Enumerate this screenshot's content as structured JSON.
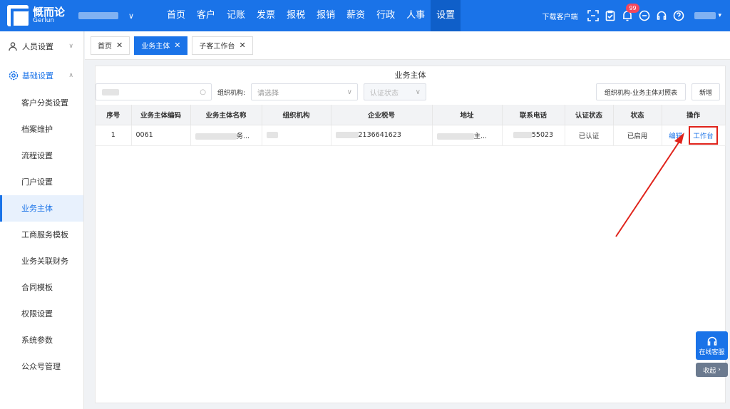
{
  "brand": {
    "name": "慨而论",
    "sub": "Gerlun"
  },
  "topnav": [
    "首页",
    "客户",
    "记账",
    "发票",
    "报税",
    "报销",
    "薪资",
    "行政",
    "人事",
    "设置"
  ],
  "topnav_active": "设置",
  "top_right": {
    "download": "下载客户端",
    "badge": "99"
  },
  "sidebar": {
    "groups": [
      {
        "label": "人员设置",
        "icon": "person-icon"
      },
      {
        "label": "基础设置",
        "icon": "gear-icon"
      }
    ],
    "items": [
      "客户分类设置",
      "档案维护",
      "流程设置",
      "门户设置",
      "业务主体",
      "工商服务模板",
      "业务关联财务",
      "合同模板",
      "权限设置",
      "系统参数",
      "公众号管理"
    ],
    "active": "业务主体"
  },
  "tabs": [
    {
      "label": "首页"
    },
    {
      "label": "业务主体"
    },
    {
      "label": "子客工作台"
    }
  ],
  "panel": {
    "title": "业务主体",
    "org_label": "组织机构:",
    "org_placeholder": "请选择",
    "status_placeholder": "认证状态",
    "btn_report": "组织机构-业务主体对照表",
    "btn_add": "新增"
  },
  "table": {
    "headers": [
      "序号",
      "业务主体编码",
      "业务主体名称",
      "组织机构",
      "企业税号",
      "地址",
      "联系电话",
      "认证状态",
      "状态",
      "操作"
    ],
    "rows": [
      {
        "index": "1",
        "code": "0061",
        "name_tail": "务...",
        "tax_tail": "2136641623",
        "addr_tail": "主...",
        "phone_tail": "55023",
        "auth": "已认证",
        "status": "已启用",
        "op_edit": "编辑",
        "op_work": "工作台"
      }
    ]
  },
  "widget": {
    "service": "在线客服",
    "collapse": "收起"
  },
  "colors": {
    "primary": "#1a73e8",
    "annotation": "#e0231b"
  }
}
